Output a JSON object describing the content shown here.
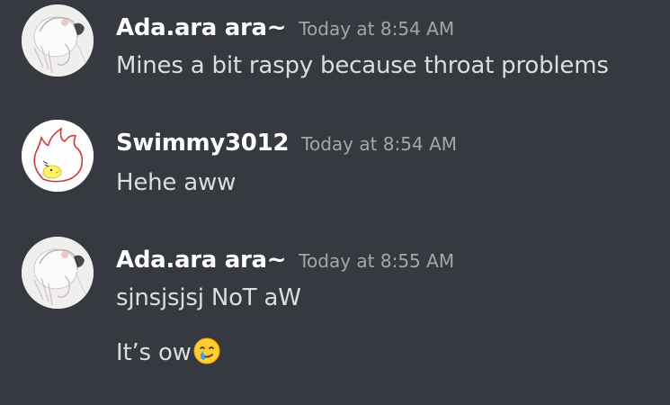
{
  "messages": [
    {
      "username": "Ada.ara ara~",
      "timestamp": "Today at 8:54 AM",
      "lines": [
        "Mines a bit raspy because throat problems"
      ],
      "avatar_icon": "anime-sketch-avatar"
    },
    {
      "username": "Swimmy3012",
      "timestamp": "Today at 8:54 AM",
      "lines": [
        "Hehe aww"
      ],
      "avatar_icon": "flame-chick-avatar"
    },
    {
      "username": "Ada.ara ara~",
      "timestamp": "Today at 8:55 AM",
      "lines": [
        "sjnsjsjsj NoT aW",
        "It’s ow"
      ],
      "avatar_icon": "anime-sketch-avatar",
      "trailing_emoji": "smiling-face-with-tear"
    }
  ],
  "colors": {
    "background": "#36393f",
    "username": "#ffffff",
    "timestamp": "#a3a6aa",
    "message_text": "#dcddde"
  }
}
